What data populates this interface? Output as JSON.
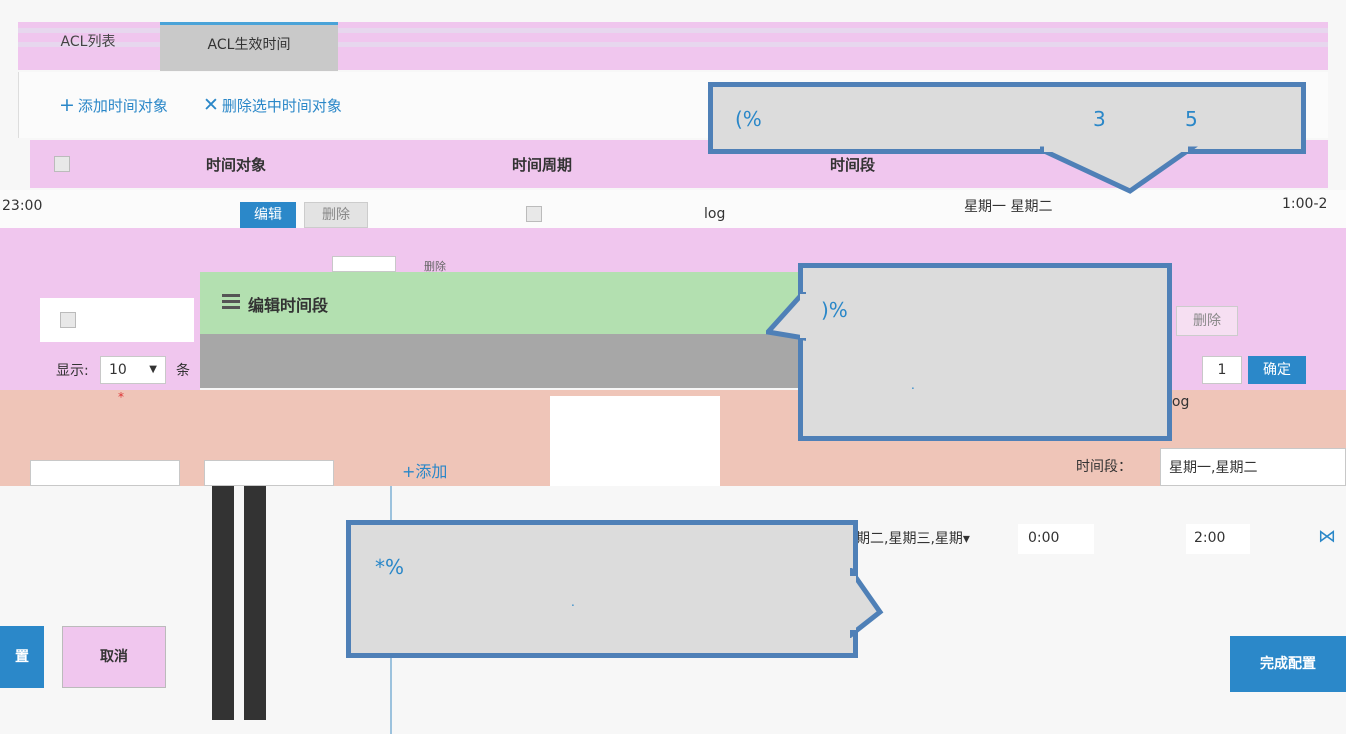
{
  "tabs": [
    "ACL列表",
    "ACL生效时间"
  ],
  "toolbar": {
    "add_label": "添加时间对象",
    "add_icon": "+",
    "delete_label": "删除选中时间对象",
    "delete_icon": "✕"
  },
  "table": {
    "headers": [
      "时间对象",
      "时间周期",
      "时间段"
    ],
    "row": {
      "time_left": "23:00",
      "edit": "编辑",
      "delete": "删除",
      "name": "log",
      "period": "星期一 星期二",
      "time_right": "1:00-2"
    },
    "row2_delete": "删除"
  },
  "modal": {
    "title": "编辑时间段",
    "show_label": "显示:",
    "page_size": "10",
    "unit": "条",
    "right_delete": "删除",
    "page_input": "1",
    "confirm": "确定",
    "right_name": "log",
    "required_mark": "*"
  },
  "form": {
    "add_label": "添加",
    "time_period_label": "时间段：",
    "weekday_select": "星期一,星期二",
    "weekday_row2": "期二,星期三,星期▾",
    "start_time": "0:00",
    "end_time": "2:00",
    "cancel": "取消",
    "save": "置",
    "finish": "完成配置"
  },
  "callouts": [
    {
      "text": "(%",
      "extra1": "3",
      "extra2": "5",
      "dot": ""
    },
    {
      "text": ")%",
      "dot": "."
    },
    {
      "text": "*%",
      "dot": "."
    }
  ],
  "colors": {
    "accent": "#2b88c9",
    "callout_border": "#4f80b7",
    "callout_fill": "#dcdcdc",
    "pink": "#f0c6ee",
    "green": "#b3e0b0",
    "peach": "#efc5b8"
  }
}
